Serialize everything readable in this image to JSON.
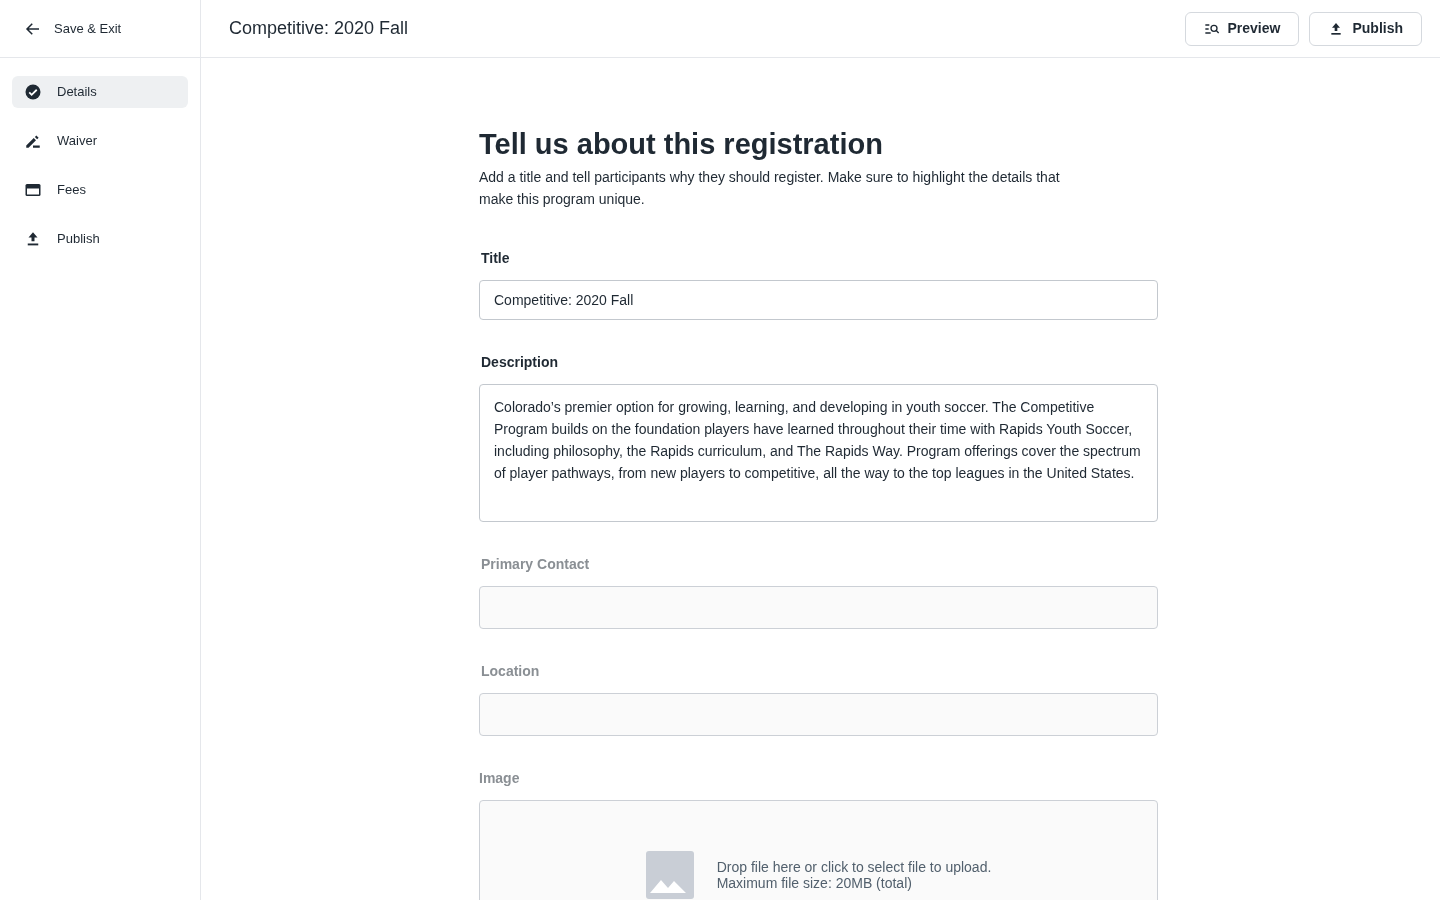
{
  "header": {
    "back_label": "Save & Exit",
    "title": "Competitive: 2020 Fall",
    "buttons": [
      {
        "kind": "preview",
        "label": "Preview"
      },
      {
        "kind": "publish",
        "label": "Publish"
      }
    ]
  },
  "sidebar": {
    "items": [
      {
        "label": "Details",
        "selected": true
      },
      {
        "label": "Waiver",
        "selected": false
      },
      {
        "label": "Fees",
        "selected": false
      },
      {
        "label": "Publish",
        "selected": false
      }
    ]
  },
  "form": {
    "heading": "Tell us about this registration",
    "intro": "Add a title and tell participants why they should register. Make sure to highlight the details that make this program unique.",
    "fields": [
      {
        "kind": "text",
        "label": "Title",
        "value": "Competitive: 2020 Fall",
        "disabled": false
      },
      {
        "kind": "textarea",
        "label": "Description",
        "value": "Colorado’s premier option for growing, learning, and developing in youth soccer. The Competitive Program builds on the foundation players have learned throughout their time with Rapids Youth Soccer, including philosophy, the Rapids curriculum, and The Rapids Way. Program offerings cover the spectrum of player pathways, from new players to competitive, all the way to the top leagues in the United States.",
        "disabled": false
      },
      {
        "kind": "text",
        "label": "Primary Contact",
        "disabled": true
      },
      {
        "kind": "text",
        "label": "Location",
        "disabled": true
      },
      {
        "kind": "image",
        "label": "Image",
        "hint": "Drop file here or click to select file to upload.",
        "limit": "Maximum file size:  20MB (total)",
        "disabled": true
      }
    ]
  }
}
